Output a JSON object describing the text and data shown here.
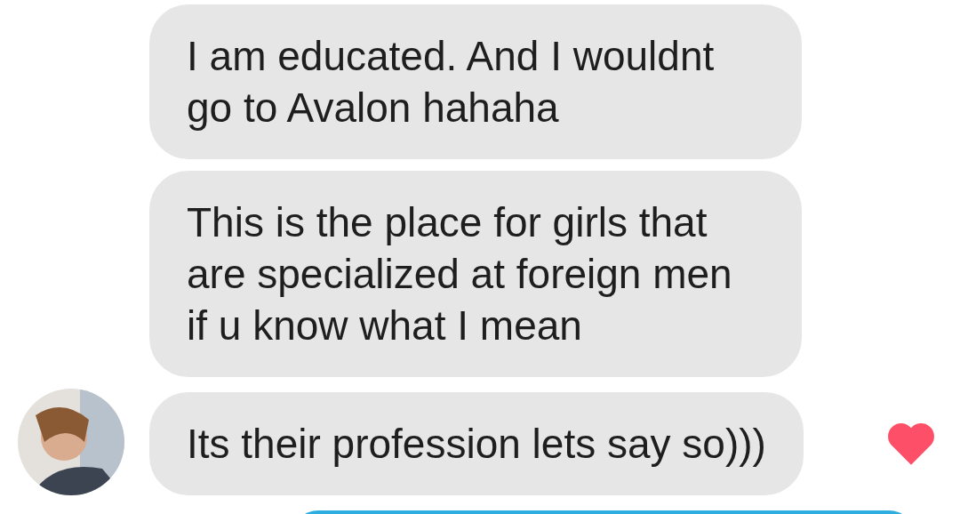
{
  "messages": [
    {
      "kind": "incoming",
      "text": "I am educated. And I wouldnt\ngo to Avalon hahaha",
      "show_avatar": false,
      "liked": false
    },
    {
      "kind": "incoming",
      "text": "This is the place for girls that\nare specialized at foreign men\nif u know what I mean",
      "show_avatar": false,
      "liked": false
    },
    {
      "kind": "incoming",
      "text": "Its their profession lets say so)))",
      "show_avatar": true,
      "liked": true
    },
    {
      "kind": "outgoing"
    }
  ]
}
